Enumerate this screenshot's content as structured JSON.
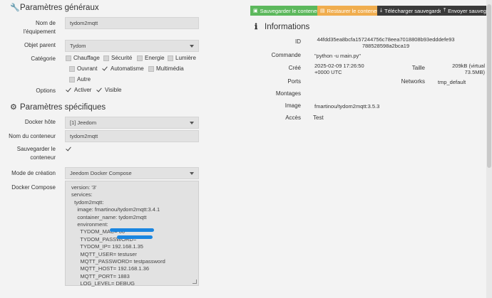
{
  "general": {
    "title": "Paramètres généraux",
    "name_label_1": "Nom de",
    "name_label_2": "l'équipement",
    "name_value": "tydom2mqtt",
    "parent_label": "Objet parent",
    "parent_value": "Tydom",
    "category_label": "Catégorie",
    "categories": [
      {
        "label": "Chauffage",
        "checked": false
      },
      {
        "label": "Sécurité",
        "checked": false
      },
      {
        "label": "Energie",
        "checked": false
      },
      {
        "label": "Lumière",
        "checked": false
      },
      {
        "label": "Ouvrant",
        "checked": false
      },
      {
        "label": "Automatisme",
        "checked": true
      },
      {
        "label": "Multimédia",
        "checked": false
      },
      {
        "label": "Autre",
        "checked": false
      }
    ],
    "options_label": "Options",
    "options": [
      {
        "label": "Activer",
        "checked": true
      },
      {
        "label": "Visible",
        "checked": true
      }
    ]
  },
  "specific": {
    "title": "Paramètres spécifiques",
    "host_label": "Docker hôte",
    "host_value": "[1] Jeedom",
    "container_label": "Nom du conteneur",
    "container_value": "tydom2mqtt",
    "save_label_1": "Sauvegarder le",
    "save_label_2": "conteneur",
    "mode_label": "Mode de création",
    "mode_value": "Jeedom Docker Compose",
    "compose_label": "Docker Compose",
    "compose_lines": [
      "version: '3'",
      "services:",
      "  tydom2mqtt:",
      "    image: fmartinou/tydom2mqtt:3.4.1",
      "    container_name: tydom2mqtt",
      "    environment:",
      "      TYDOM_MAC= 00",
      "      TYDOM_PASSWORD=",
      "      TYDOM_IP= 192.168.1.35",
      "      MQTT_USER= testuser",
      "      MQTT_PASSWORD= testpassword",
      "      MQTT_HOST= 192.168.1.36",
      "      MQTT_PORT= 1883",
      "      LOG_LEVEL= DEBUG"
    ]
  },
  "toolbar": {
    "save": "Sauvegarder le conteneur",
    "restore": "Restaurer le conteneur",
    "download": "Télécharger sauvegarde",
    "send": "Envoyer sauvegarde"
  },
  "info": {
    "title": "Informations",
    "id_label": "ID",
    "id_line_1": "44fdd35ea8bcfa157244756c78eea7018808b93edddefe93",
    "id_line_2": "788528598a2bca19",
    "command_label": "Commande",
    "command_value": "\"python -u main.py\"",
    "created_label": "Créé",
    "created_line_1": "2025-02-09 17:26:50",
    "created_line_2": "+0000 UTC",
    "size_label": "Taille",
    "size_line_1": "209kB (virtual",
    "size_line_2": "73.5MB)",
    "ports_label": "Ports",
    "networks_label": "Networks",
    "networks_value": "tmp_default",
    "mounts_label": "Montages",
    "image_label": "Image",
    "image_value": "fmartinou/tydom2mqtt:3.5.3",
    "access_label": "Accès",
    "access_value": "Test"
  },
  "colors": {
    "save": "#5cb85c",
    "restore": "#f0ad4e",
    "dark": "#3a3a3a",
    "redaction": "#1a86e0"
  }
}
